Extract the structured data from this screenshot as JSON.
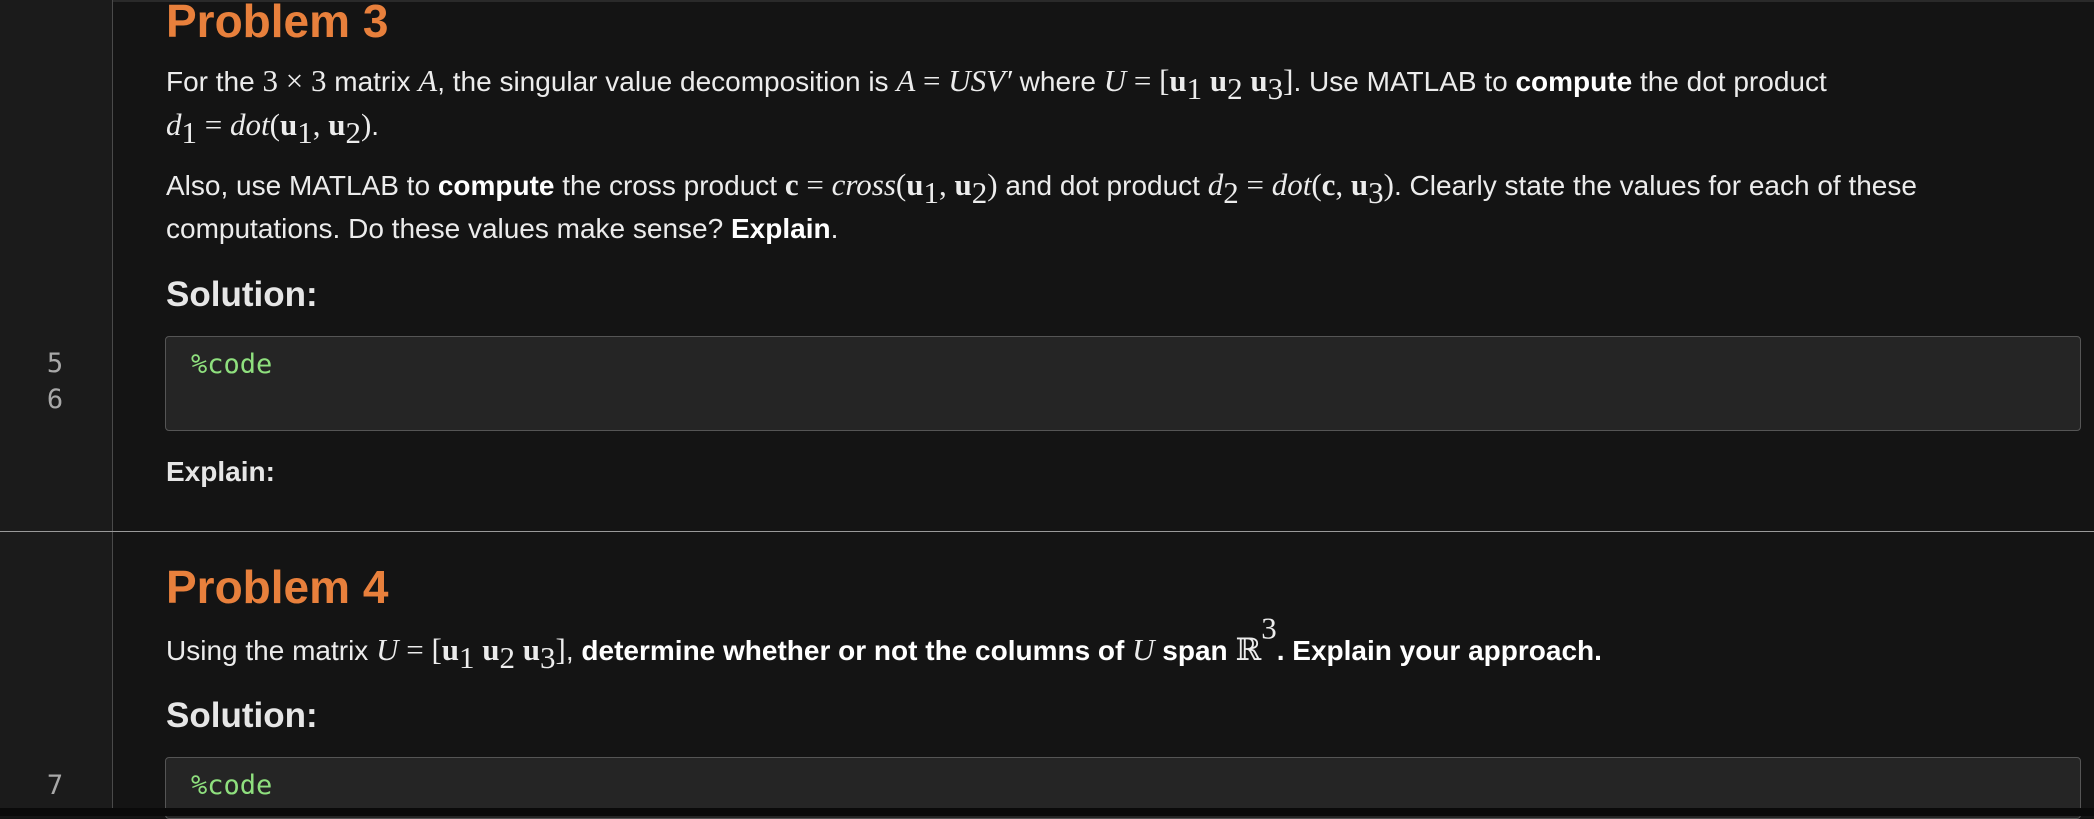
{
  "cell3": {
    "title": "Problem 3",
    "p1_a": "For the ",
    "p1_m1": "3 × 3",
    "p1_b": " matrix ",
    "p1_m2": "A",
    "p1_c": ", the singular value decomposition is ",
    "p1_m3a": "A",
    "p1_m3b": " = ",
    "p1_m3c": "USV′",
    "p1_d": " where ",
    "p1_m4a": "U",
    "p1_m4b": " = [",
    "p1_m4c": "u",
    "p1_sub1": "1",
    "p1_m4d": " u",
    "p1_sub2": "2",
    "p1_m4e": " u",
    "p1_sub3": "3",
    "p1_m4f": "]",
    "p1_e": ". Use MATLAB to ",
    "p1_bold": "compute",
    "p1_f": " the dot product",
    "p1_l2_m1": "d",
    "p1_l2_sub": "1",
    "p1_l2_m2": " = ",
    "p1_l2_m3": "dot",
    "p1_l2_m4": "(",
    "p1_l2_m5": "u",
    "p1_l2_sub2": "1",
    "p1_l2_m6": ", ",
    "p1_l2_m7": "u",
    "p1_l2_sub3": "2",
    "p1_l2_m8": ")",
    "p1_l2_end": ".",
    "p2_a": "Also, use MATLAB to ",
    "p2_bold1": "compute",
    "p2_b": " the cross product ",
    "p2_m1": "c",
    "p2_m2": " = ",
    "p2_m3": "cross",
    "p2_m4": "(",
    "p2_m5": "u",
    "p2_sub1": "1",
    "p2_m6": ", ",
    "p2_m7": "u",
    "p2_sub2": "2",
    "p2_m8": ")",
    "p2_c": " and dot product ",
    "p2_m9": "d",
    "p2_sub3": "2",
    "p2_m10": " = ",
    "p2_m11": "dot",
    "p2_m12": "(",
    "p2_m13": "c",
    "p2_m14": ", ",
    "p2_m15": "u",
    "p2_sub4": "3",
    "p2_m16": ")",
    "p2_d": ". Clearly state the values for each of these",
    "p2_l2a": "computations. Do these values make sense? ",
    "p2_bold2": "Explain",
    "p2_l2b": ".",
    "solution": "Solution:",
    "code_lines": [
      "5",
      "6"
    ],
    "code": "%code",
    "explain": "Explain:"
  },
  "cell4": {
    "title": "Problem 4",
    "p_a": "Using the matrix ",
    "p_m1": "U",
    "p_m2": " = [",
    "p_m3": "u",
    "p_sub1": "1",
    "p_m4": " u",
    "p_sub2": "2",
    "p_m5": " u",
    "p_sub3": "3",
    "p_m6": "]",
    "p_b": ", ",
    "p_bold1": "determine whether or not the columns of ",
    "p_m7": "U",
    "p_bold2": " span ",
    "p_m8": "ℝ",
    "p_sup": "3",
    "p_bold3": ". Explain your approach.",
    "solution": "Solution:",
    "code_lines": [
      "7"
    ],
    "code": "%code"
  }
}
